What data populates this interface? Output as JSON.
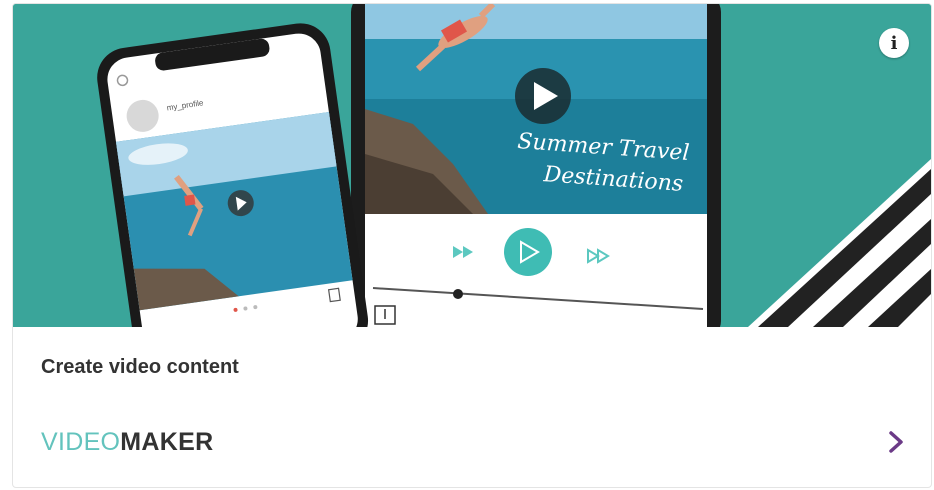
{
  "card": {
    "caption": "Create video content",
    "brand_part1": "VIDEO",
    "brand_part2": "MAKER",
    "info_glyph": "i",
    "info_icon": "info-icon",
    "chevron_icon": "chevron-right-icon"
  },
  "hero": {
    "tablet_video_title_line1": "Summer Travel",
    "tablet_video_title_line2": "Destinations",
    "phone_profile_text": "my_profile"
  },
  "colors": {
    "teal_background": "#3aa59a",
    "brand_teal": "#63c3bd",
    "chevron_purple": "#6b3a87"
  }
}
